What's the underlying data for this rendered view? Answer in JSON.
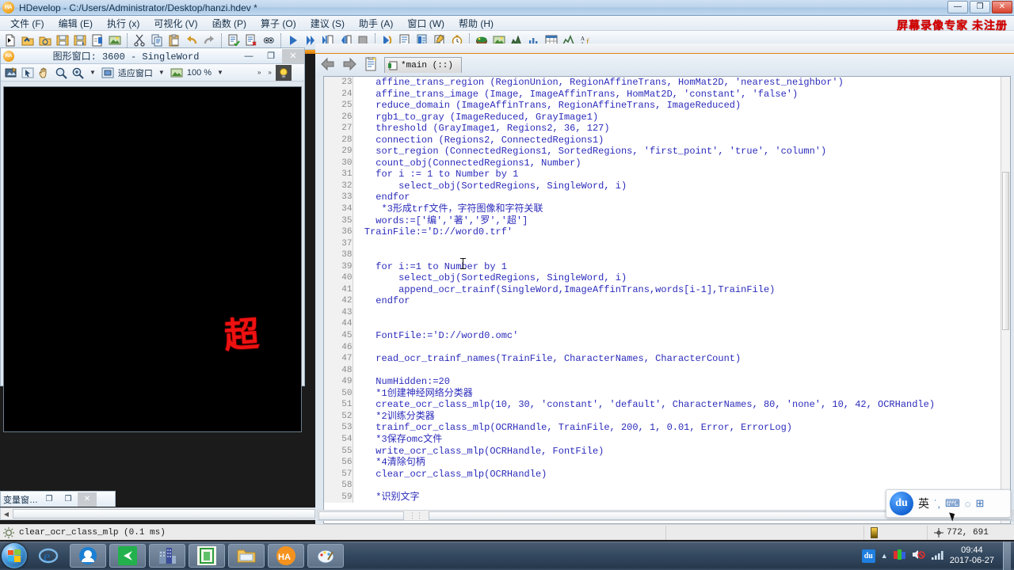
{
  "window": {
    "title": "HDevelop - C:/Users/Administrator/Desktop/hanzi.hdev *",
    "icon": "HA",
    "minimize": "—",
    "maximize": "❐",
    "close": "✕"
  },
  "watermark": "屏幕录像专家  未注册",
  "menu": [
    {
      "label": "文件 (F)"
    },
    {
      "label": "编辑 (E)"
    },
    {
      "label": "执行 (x)"
    },
    {
      "label": "可视化 (V)"
    },
    {
      "label": "函数 (P)"
    },
    {
      "label": "算子 (O)"
    },
    {
      "label": "建议 (S)"
    },
    {
      "label": "助手 (A)"
    },
    {
      "label": "窗口 (W)"
    },
    {
      "label": "帮助 (H)"
    }
  ],
  "toolbar_icons": [
    "new-file-icon",
    "open-file-icon",
    "open-recent-icon",
    "save-icon",
    "save-as-icon",
    "export-icon",
    "image-acquisition-icon",
    "cut-icon",
    "copy-icon",
    "paste-icon",
    "undo-icon",
    "redo-icon",
    "comment-icon",
    "uncomment-icon",
    "find-icon",
    "run-icon",
    "step-over-icon",
    "step-into-icon",
    "step-out-icon",
    "stop-icon",
    "reset-icon",
    "insert-line-icon",
    "edit-proc-icon",
    "proc-list-icon",
    "timer-icon",
    "variable-window-icon",
    "graphics-window-icon",
    "gray-histogram-icon",
    "feature-histogram-icon",
    "image-table-icon",
    "profile-icon",
    "font-icon"
  ],
  "graphics_window": {
    "title": "图形窗口: 3600 - SingleWord",
    "minimize": "—",
    "maximize": "❐",
    "close": "✕",
    "toolbar": {
      "draw_mode_icon": "draw-mode-icon",
      "select_icon": "arrow-select-icon",
      "pan_icon": "hand-pan-icon",
      "zoom_icon": "magnifier-icon",
      "zoom_in_icon": "magnifier-plus-icon",
      "fit_label": "适应窗口",
      "zoom_value": "100 %",
      "overflow": "»",
      "overflow2": "»",
      "lamp_icon": "lightbulb-icon"
    },
    "canvas_glyph": "超"
  },
  "variable_window": {
    "title": "变量窗…",
    "restore": "❐",
    "maximize": "❐",
    "close": "✕"
  },
  "editor": {
    "nav_back_icon": "arrow-left-icon",
    "nav_forward_icon": "arrow-right-icon",
    "proc_icon": "procedure-icon",
    "tab": {
      "icon": "main-proc-icon",
      "label": "*main (::)"
    },
    "code": [
      {
        "num": "23",
        "text": "    affine_trans_region (RegionUnion, RegionAffineTrans, HomMat2D, 'nearest_neighbor')",
        "comment": false
      },
      {
        "num": "24",
        "text": "    affine_trans_image (Image, ImageAffinTrans, HomMat2D, 'constant', 'false')",
        "comment": false
      },
      {
        "num": "25",
        "text": "    reduce_domain (ImageAffinTrans, RegionAffineTrans, ImageReduced)",
        "comment": false
      },
      {
        "num": "26",
        "text": "    rgb1_to_gray (ImageReduced, GrayImage1)",
        "comment": false
      },
      {
        "num": "27",
        "text": "    threshold (GrayImage1, Regions2, 36, 127)",
        "comment": false
      },
      {
        "num": "28",
        "text": "    connection (Regions2, ConnectedRegions1)",
        "comment": false
      },
      {
        "num": "29",
        "text": "    sort_region (ConnectedRegions1, SortedRegions, 'first_point', 'true', 'column')",
        "comment": false
      },
      {
        "num": "30",
        "text": "    count_obj(ConnectedRegions1, Number)",
        "comment": false
      },
      {
        "num": "31",
        "text": "    for i := 1 to Number by 1",
        "comment": false
      },
      {
        "num": "32",
        "text": "        select_obj(SortedRegions, SingleWord, i)",
        "comment": false
      },
      {
        "num": "33",
        "text": "    endfor",
        "comment": false
      },
      {
        "num": "34",
        "text": "     *3形成trf文件，字符图像和字符关联",
        "comment": true
      },
      {
        "num": "35",
        "text": "    words:=['编','著','罗','超']",
        "comment": false
      },
      {
        "num": "36",
        "text": "  TrainFile:='D://word0.trf'",
        "comment": false
      },
      {
        "num": "37",
        "text": "",
        "comment": false
      },
      {
        "num": "38",
        "text": "",
        "comment": false
      },
      {
        "num": "39",
        "text": "    for i:=1 to Number by 1",
        "comment": false
      },
      {
        "num": "40",
        "text": "        select_obj(SortedRegions, SingleWord, i)",
        "comment": false
      },
      {
        "num": "41",
        "text": "        append_ocr_trainf(SingleWord,ImageAffinTrans,words[i-1],TrainFile)",
        "comment": false
      },
      {
        "num": "42",
        "text": "    endfor",
        "comment": false
      },
      {
        "num": "43",
        "text": "",
        "comment": false
      },
      {
        "num": "44",
        "text": "",
        "comment": false
      },
      {
        "num": "45",
        "text": "    FontFile:='D://word0.omc'",
        "comment": false
      },
      {
        "num": "46",
        "text": "",
        "comment": false
      },
      {
        "num": "47",
        "text": "    read_ocr_trainf_names(TrainFile, CharacterNames, CharacterCount)",
        "comment": false
      },
      {
        "num": "48",
        "text": "",
        "comment": false
      },
      {
        "num": "49",
        "text": "    NumHidden:=20",
        "comment": false
      },
      {
        "num": "50",
        "text": "    *1创建神经网络分类器",
        "comment": true
      },
      {
        "num": "51",
        "text": "    create_ocr_class_mlp(10, 30, 'constant', 'default', CharacterNames, 80, 'none', 10, 42, OCRHandle)",
        "comment": false
      },
      {
        "num": "52",
        "text": "    *2训练分类器",
        "comment": true
      },
      {
        "num": "53",
        "text": "    trainf_ocr_class_mlp(OCRHandle, TrainFile, 200, 1, 0.01, Error, ErrorLog)",
        "comment": false
      },
      {
        "num": "54",
        "text": "    *3保存omc文件",
        "comment": true
      },
      {
        "num": "55",
        "text": "    write_ocr_class_mlp(OCRHandle, FontFile)",
        "comment": false
      },
      {
        "num": "56",
        "text": "    *4清除句柄",
        "comment": true
      },
      {
        "num": "57",
        "text": "    clear_ocr_class_mlp(OCRHandle)",
        "comment": false
      },
      {
        "num": "58",
        "text": "",
        "comment": false
      },
      {
        "num": "59",
        "text": "    *识别文字",
        "comment": true
      }
    ]
  },
  "status": {
    "message": "clear_ocr_class_mlp  (0.1 ms)",
    "cell_blank": "",
    "lamp_cell": "",
    "coords_icon": "cursor-coords-icon",
    "coords": "772, 691"
  },
  "ime": {
    "logo": "du",
    "mode": "英",
    "punct_icon": "punctuation-icon",
    "keyboard_icon": "soft-keyboard-icon",
    "user_icon": "user-icon",
    "menu_icon": "grid-menu-icon"
  },
  "taskbar": {
    "start": "start-orb-icon",
    "items": [
      {
        "name": "internet-explorer-icon"
      },
      {
        "name": "qq-browser-icon"
      },
      {
        "name": "green-app-icon"
      },
      {
        "name": "blue-buildings-icon"
      },
      {
        "name": "green-door-icon"
      },
      {
        "name": "folder-explorer-icon"
      },
      {
        "name": "halcon-icon"
      },
      {
        "name": "paint-icon"
      }
    ],
    "tray": {
      "ime": "du",
      "show_hidden": "▲",
      "recorder_icon": "screen-recorder-icon",
      "volume_icon": "volume-muted-icon",
      "network_icon": "network-signal-icon",
      "time": "09:44",
      "date": "2017-06-27"
    }
  },
  "colors": {
    "code_blue": "#2b2bbb",
    "comment_green": "#128c3c",
    "accent_orange": "#f0890f",
    "watermark_red": "#d40000",
    "glyph_red": "#ee1111"
  }
}
